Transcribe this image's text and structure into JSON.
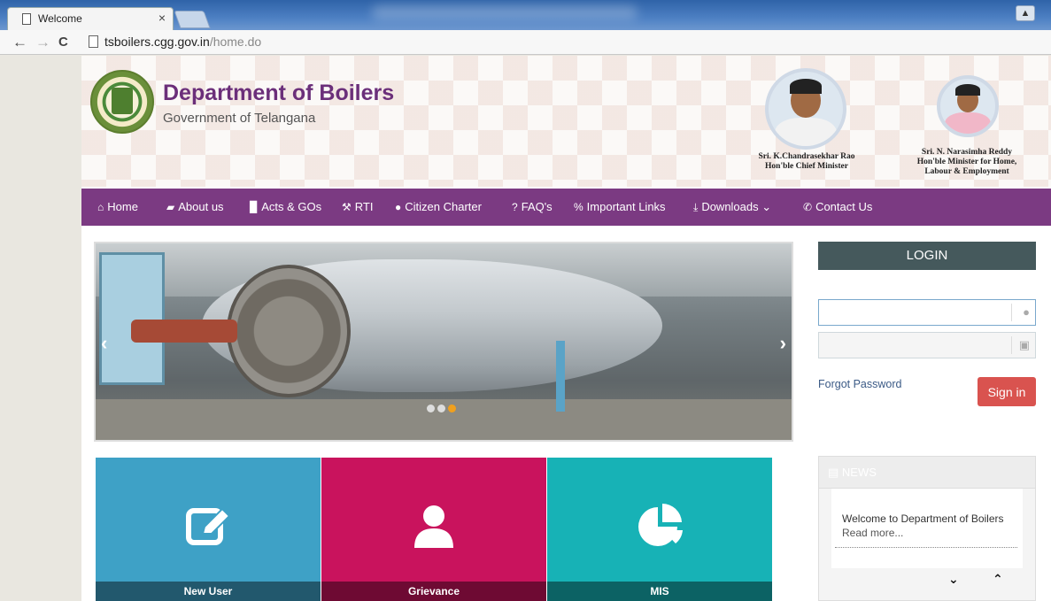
{
  "browser": {
    "tab_title": "Welcome",
    "tab_close": "×",
    "url_host": "tsboilers.cgg.gov.in",
    "url_path": "/home.do",
    "nav_back": "←",
    "nav_forward": "→",
    "nav_reload": "C"
  },
  "header": {
    "title": "Department of Boilers",
    "subtitle": "Government of Telangana",
    "officials": [
      {
        "name": "Sri. K.Chandrasekhar Rao",
        "role": "Hon'ble Chief Minister"
      },
      {
        "name": "Sri. N. Narasimha Reddy",
        "role": "Hon'ble Minister for Home,",
        "role2": "Labour & Employment"
      }
    ]
  },
  "nav": {
    "items": [
      {
        "label": "Home",
        "icon": "home-icon",
        "glyph": "⌂"
      },
      {
        "label": "About us",
        "icon": "book-icon",
        "glyph": "▰"
      },
      {
        "label": "Acts & GOs",
        "icon": "file-icon",
        "glyph": "▉"
      },
      {
        "label": "RTI",
        "icon": "gavel-icon",
        "glyph": "⚒"
      },
      {
        "label": "Citizen Charter",
        "icon": "user-icon",
        "glyph": "●"
      },
      {
        "label": "FAQ's",
        "icon": "question-icon",
        "glyph": "?"
      },
      {
        "label": "Important Links",
        "icon": "link-icon",
        "glyph": "%"
      },
      {
        "label": "Downloads",
        "icon": "download-icon",
        "glyph": "⤓",
        "caret": "⌄"
      },
      {
        "label": "Contact Us",
        "icon": "phone-icon",
        "glyph": "✆"
      }
    ]
  },
  "slider": {
    "prev": "‹",
    "next": "›",
    "slide_count": 3,
    "active_slide": 3
  },
  "tiles": [
    {
      "label": "New User",
      "icon": "edit-icon"
    },
    {
      "label": "Grievance",
      "icon": "user-icon"
    },
    {
      "label": "MIS",
      "icon": "pie-chart-icon"
    }
  ],
  "login": {
    "title": "LOGIN",
    "username_value": "",
    "password_value": "",
    "forgot": "Forgot Password",
    "signin": "Sign in"
  },
  "news": {
    "title": "NEWS",
    "text": "Welcome to Department of Boilers",
    "more": "Read more...",
    "down": "⌄",
    "up": "⌃"
  },
  "colors": {
    "nav_bg": "#7b3a82",
    "title": "#6b2f7a",
    "tile_new_user": "#3ea1c6",
    "tile_grievance": "#c9135d",
    "tile_mis": "#17b2b6",
    "signin": "#d9534f",
    "login_head": "#45595c"
  }
}
